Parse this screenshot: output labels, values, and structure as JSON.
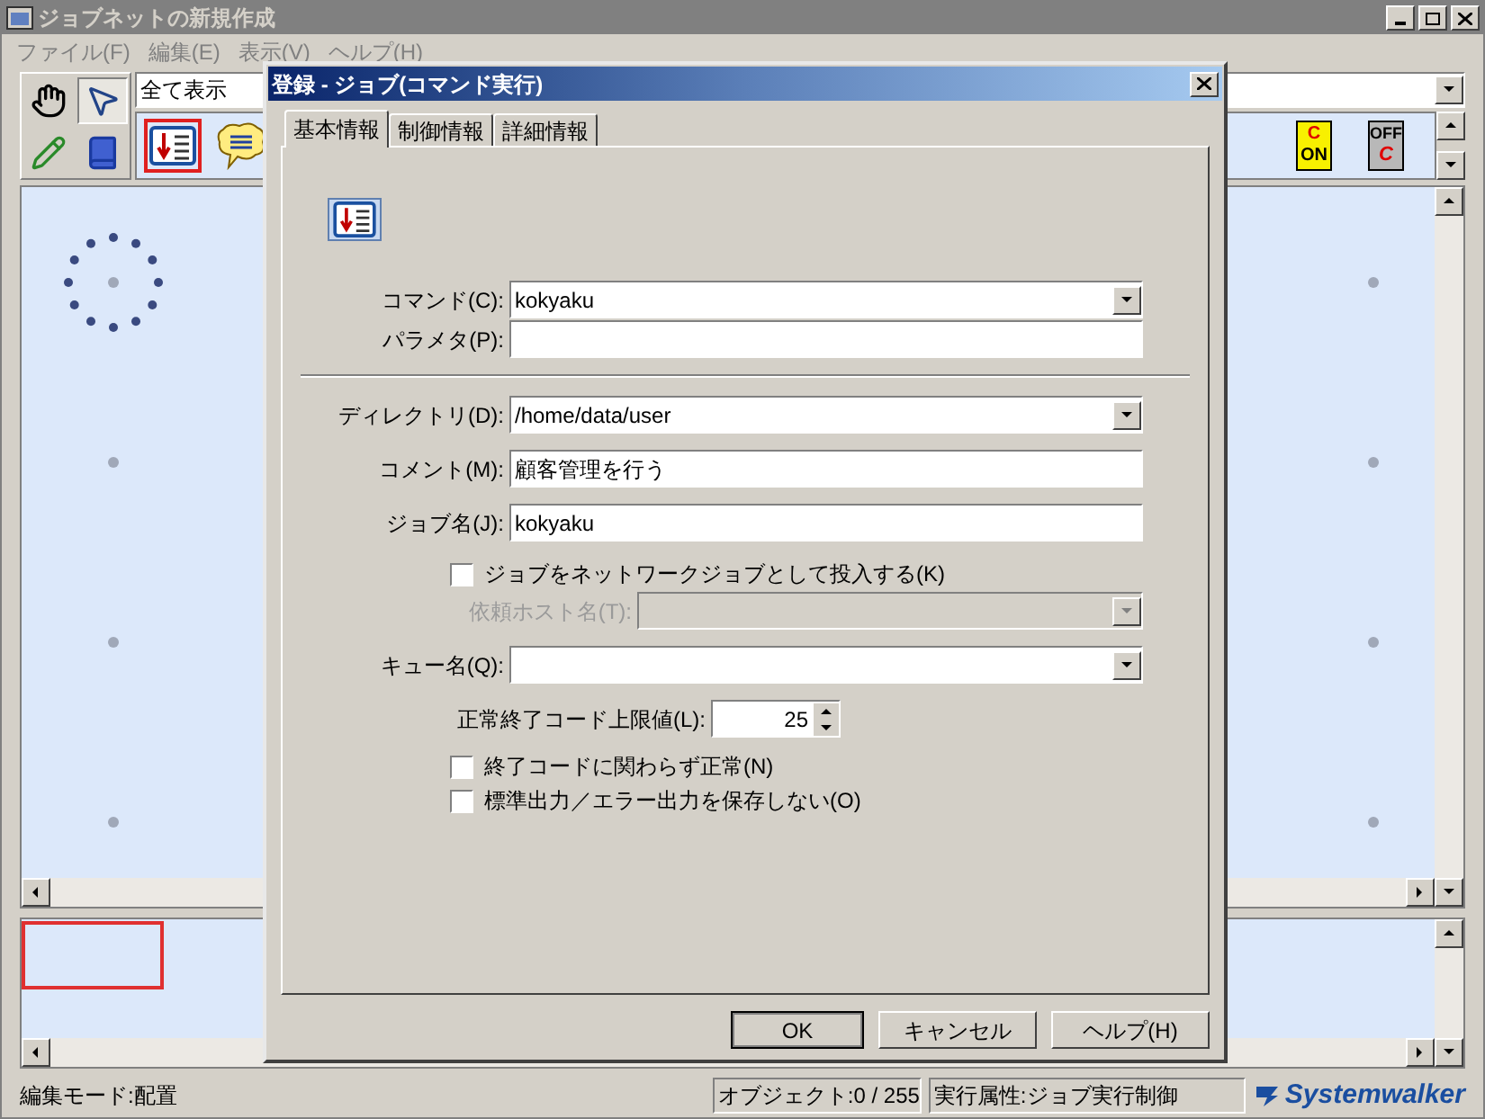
{
  "window": {
    "title": "ジョブネットの新規作成"
  },
  "menu": [
    "ファイル(F)",
    "編集(E)",
    "表示(V)",
    "ヘルプ(H)"
  ],
  "view_filter": {
    "value": "全て表示"
  },
  "tools": [
    {
      "kind": "hand",
      "selected": false
    },
    {
      "kind": "pointer",
      "selected": true
    },
    {
      "kind": "pencil",
      "selected": false
    },
    {
      "kind": "book",
      "selected": false
    }
  ],
  "job_icons": [
    {
      "kind": "command",
      "selected": true
    },
    {
      "kind": "message",
      "selected": false
    },
    {
      "kind": "switch_on",
      "top": "C",
      "bottom": "ON",
      "selected": false
    },
    {
      "kind": "switch_off",
      "top": "OFF",
      "bottom": "C",
      "selected": false
    }
  ],
  "dialog": {
    "title": "登録 - ジョブ(コマンド実行)",
    "tabs": [
      {
        "label": "基本情報",
        "selected": true
      },
      {
        "label": "制御情報",
        "selected": false
      },
      {
        "label": "詳細情報",
        "selected": false
      }
    ],
    "sections": [
      [
        {
          "kind": "combo",
          "label": "コマンド(C):",
          "value": "kokyaku",
          "disabled": false
        },
        {
          "kind": "text",
          "label": "パラメタ(P):",
          "disabled": false
        }
      ],
      [
        {
          "kind": "combo",
          "label": "ディレクトリ(D):",
          "value": "/home/data/user",
          "disabled": false
        },
        {
          "kind": "text",
          "label": "コメント(M):",
          "value": "顧客管理を行う",
          "disabled": false
        },
        {
          "kind": "text",
          "label": "ジョブ名(J):",
          "value": "kokyaku",
          "disabled": false
        },
        {
          "kind": "checkbox",
          "label": "ジョブをネットワークジョブとして投入する(K)",
          "checked": false,
          "disabled": false
        },
        {
          "kind": "subcombo",
          "label": "依頼ホスト名(T):",
          "disabled": true
        },
        {
          "kind": "combo",
          "label": "キュー名(Q):",
          "disabled": false
        },
        {
          "kind": "spin",
          "label": "正常終了コード上限値(L):",
          "value": "25",
          "disabled": false
        },
        {
          "kind": "checkbox",
          "label": "終了コードに関わらず正常(N)",
          "checked": false,
          "disabled": false
        },
        {
          "kind": "checkbox",
          "label": "標準出力／エラー出力を保存しない(O)",
          "checked": false,
          "disabled": false
        }
      ]
    ],
    "buttons": [
      {
        "label": "OK",
        "default": true
      },
      {
        "label": "キャンセル",
        "default": false
      },
      {
        "label": "ヘルプ(H)",
        "default": false
      }
    ]
  },
  "status_bar": {
    "mode": "編集モード:配置",
    "objects": "オブジェクト:0 / 255",
    "attribute": "実行属性:ジョブ実行制御",
    "logo": "Systemwalker"
  }
}
